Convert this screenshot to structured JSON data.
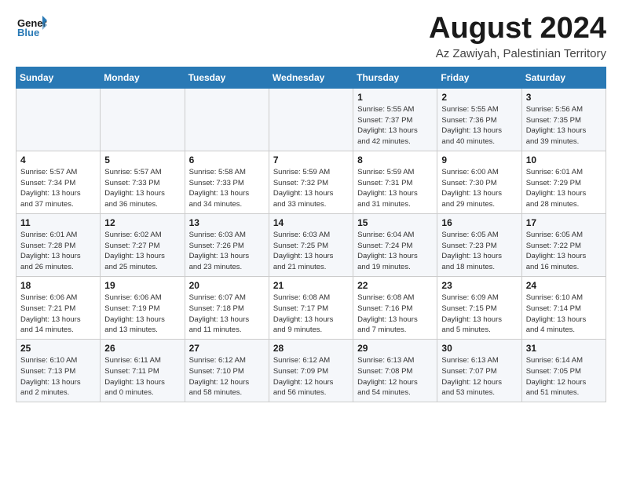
{
  "header": {
    "logo_general": "General",
    "logo_blue": "Blue",
    "month": "August 2024",
    "location": "Az Zawiyah, Palestinian Territory"
  },
  "days_of_week": [
    "Sunday",
    "Monday",
    "Tuesday",
    "Wednesday",
    "Thursday",
    "Friday",
    "Saturday"
  ],
  "weeks": [
    [
      {
        "day": "",
        "info": ""
      },
      {
        "day": "",
        "info": ""
      },
      {
        "day": "",
        "info": ""
      },
      {
        "day": "",
        "info": ""
      },
      {
        "day": "1",
        "info": "Sunrise: 5:55 AM\nSunset: 7:37 PM\nDaylight: 13 hours\nand 42 minutes."
      },
      {
        "day": "2",
        "info": "Sunrise: 5:55 AM\nSunset: 7:36 PM\nDaylight: 13 hours\nand 40 minutes."
      },
      {
        "day": "3",
        "info": "Sunrise: 5:56 AM\nSunset: 7:35 PM\nDaylight: 13 hours\nand 39 minutes."
      }
    ],
    [
      {
        "day": "4",
        "info": "Sunrise: 5:57 AM\nSunset: 7:34 PM\nDaylight: 13 hours\nand 37 minutes."
      },
      {
        "day": "5",
        "info": "Sunrise: 5:57 AM\nSunset: 7:33 PM\nDaylight: 13 hours\nand 36 minutes."
      },
      {
        "day": "6",
        "info": "Sunrise: 5:58 AM\nSunset: 7:33 PM\nDaylight: 13 hours\nand 34 minutes."
      },
      {
        "day": "7",
        "info": "Sunrise: 5:59 AM\nSunset: 7:32 PM\nDaylight: 13 hours\nand 33 minutes."
      },
      {
        "day": "8",
        "info": "Sunrise: 5:59 AM\nSunset: 7:31 PM\nDaylight: 13 hours\nand 31 minutes."
      },
      {
        "day": "9",
        "info": "Sunrise: 6:00 AM\nSunset: 7:30 PM\nDaylight: 13 hours\nand 29 minutes."
      },
      {
        "day": "10",
        "info": "Sunrise: 6:01 AM\nSunset: 7:29 PM\nDaylight: 13 hours\nand 28 minutes."
      }
    ],
    [
      {
        "day": "11",
        "info": "Sunrise: 6:01 AM\nSunset: 7:28 PM\nDaylight: 13 hours\nand 26 minutes."
      },
      {
        "day": "12",
        "info": "Sunrise: 6:02 AM\nSunset: 7:27 PM\nDaylight: 13 hours\nand 25 minutes."
      },
      {
        "day": "13",
        "info": "Sunrise: 6:03 AM\nSunset: 7:26 PM\nDaylight: 13 hours\nand 23 minutes."
      },
      {
        "day": "14",
        "info": "Sunrise: 6:03 AM\nSunset: 7:25 PM\nDaylight: 13 hours\nand 21 minutes."
      },
      {
        "day": "15",
        "info": "Sunrise: 6:04 AM\nSunset: 7:24 PM\nDaylight: 13 hours\nand 19 minutes."
      },
      {
        "day": "16",
        "info": "Sunrise: 6:05 AM\nSunset: 7:23 PM\nDaylight: 13 hours\nand 18 minutes."
      },
      {
        "day": "17",
        "info": "Sunrise: 6:05 AM\nSunset: 7:22 PM\nDaylight: 13 hours\nand 16 minutes."
      }
    ],
    [
      {
        "day": "18",
        "info": "Sunrise: 6:06 AM\nSunset: 7:21 PM\nDaylight: 13 hours\nand 14 minutes."
      },
      {
        "day": "19",
        "info": "Sunrise: 6:06 AM\nSunset: 7:19 PM\nDaylight: 13 hours\nand 13 minutes."
      },
      {
        "day": "20",
        "info": "Sunrise: 6:07 AM\nSunset: 7:18 PM\nDaylight: 13 hours\nand 11 minutes."
      },
      {
        "day": "21",
        "info": "Sunrise: 6:08 AM\nSunset: 7:17 PM\nDaylight: 13 hours\nand 9 minutes."
      },
      {
        "day": "22",
        "info": "Sunrise: 6:08 AM\nSunset: 7:16 PM\nDaylight: 13 hours\nand 7 minutes."
      },
      {
        "day": "23",
        "info": "Sunrise: 6:09 AM\nSunset: 7:15 PM\nDaylight: 13 hours\nand 5 minutes."
      },
      {
        "day": "24",
        "info": "Sunrise: 6:10 AM\nSunset: 7:14 PM\nDaylight: 13 hours\nand 4 minutes."
      }
    ],
    [
      {
        "day": "25",
        "info": "Sunrise: 6:10 AM\nSunset: 7:13 PM\nDaylight: 13 hours\nand 2 minutes."
      },
      {
        "day": "26",
        "info": "Sunrise: 6:11 AM\nSunset: 7:11 PM\nDaylight: 13 hours\nand 0 minutes."
      },
      {
        "day": "27",
        "info": "Sunrise: 6:12 AM\nSunset: 7:10 PM\nDaylight: 12 hours\nand 58 minutes."
      },
      {
        "day": "28",
        "info": "Sunrise: 6:12 AM\nSunset: 7:09 PM\nDaylight: 12 hours\nand 56 minutes."
      },
      {
        "day": "29",
        "info": "Sunrise: 6:13 AM\nSunset: 7:08 PM\nDaylight: 12 hours\nand 54 minutes."
      },
      {
        "day": "30",
        "info": "Sunrise: 6:13 AM\nSunset: 7:07 PM\nDaylight: 12 hours\nand 53 minutes."
      },
      {
        "day": "31",
        "info": "Sunrise: 6:14 AM\nSunset: 7:05 PM\nDaylight: 12 hours\nand 51 minutes."
      }
    ]
  ]
}
